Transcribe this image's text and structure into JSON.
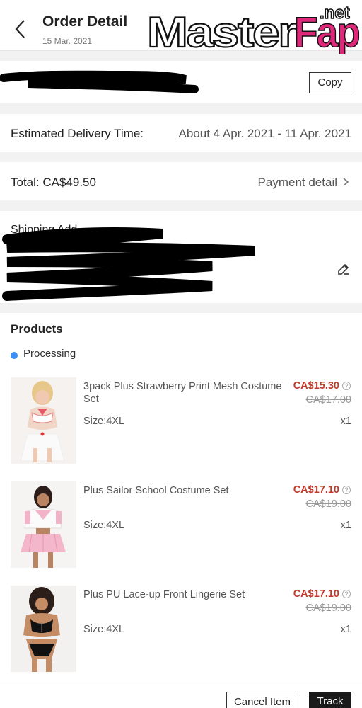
{
  "header": {
    "title": "Order Detail",
    "date": "15 Mar. 2021",
    "watermark_main": "MasterFap",
    "watermark_sub": ".net"
  },
  "order_id": {
    "copy_label": "Copy"
  },
  "delivery": {
    "label": "Estimated Delivery Time:",
    "value": "About 4 Apr. 2021 - 11 Apr. 2021"
  },
  "total": {
    "label": "Total: CA$49.50",
    "payment_link": "Payment detail"
  },
  "shipping": {
    "label_partial": "Shipping Add"
  },
  "products": {
    "title": "Products",
    "status": "Processing",
    "status_color": "#3d8ff5",
    "price_color": "#c0392b",
    "items": [
      {
        "name": "3pack Plus Strawberry Print Mesh Costume Set",
        "price": "CA$15.30",
        "original_price": "CA$17.00",
        "size": "Size:4XL",
        "qty": "x1"
      },
      {
        "name": "Plus Sailor School Costume Set",
        "price": "CA$17.10",
        "original_price": "CA$19.00",
        "size": "Size:4XL",
        "qty": "x1"
      },
      {
        "name": "Plus PU Lace-up Front Lingerie Set",
        "price": "CA$17.10",
        "original_price": "CA$19.00",
        "size": "Size:4XL",
        "qty": "x1"
      }
    ]
  },
  "actions": {
    "cancel_label": "Cancel Item",
    "track_label": "Track"
  }
}
